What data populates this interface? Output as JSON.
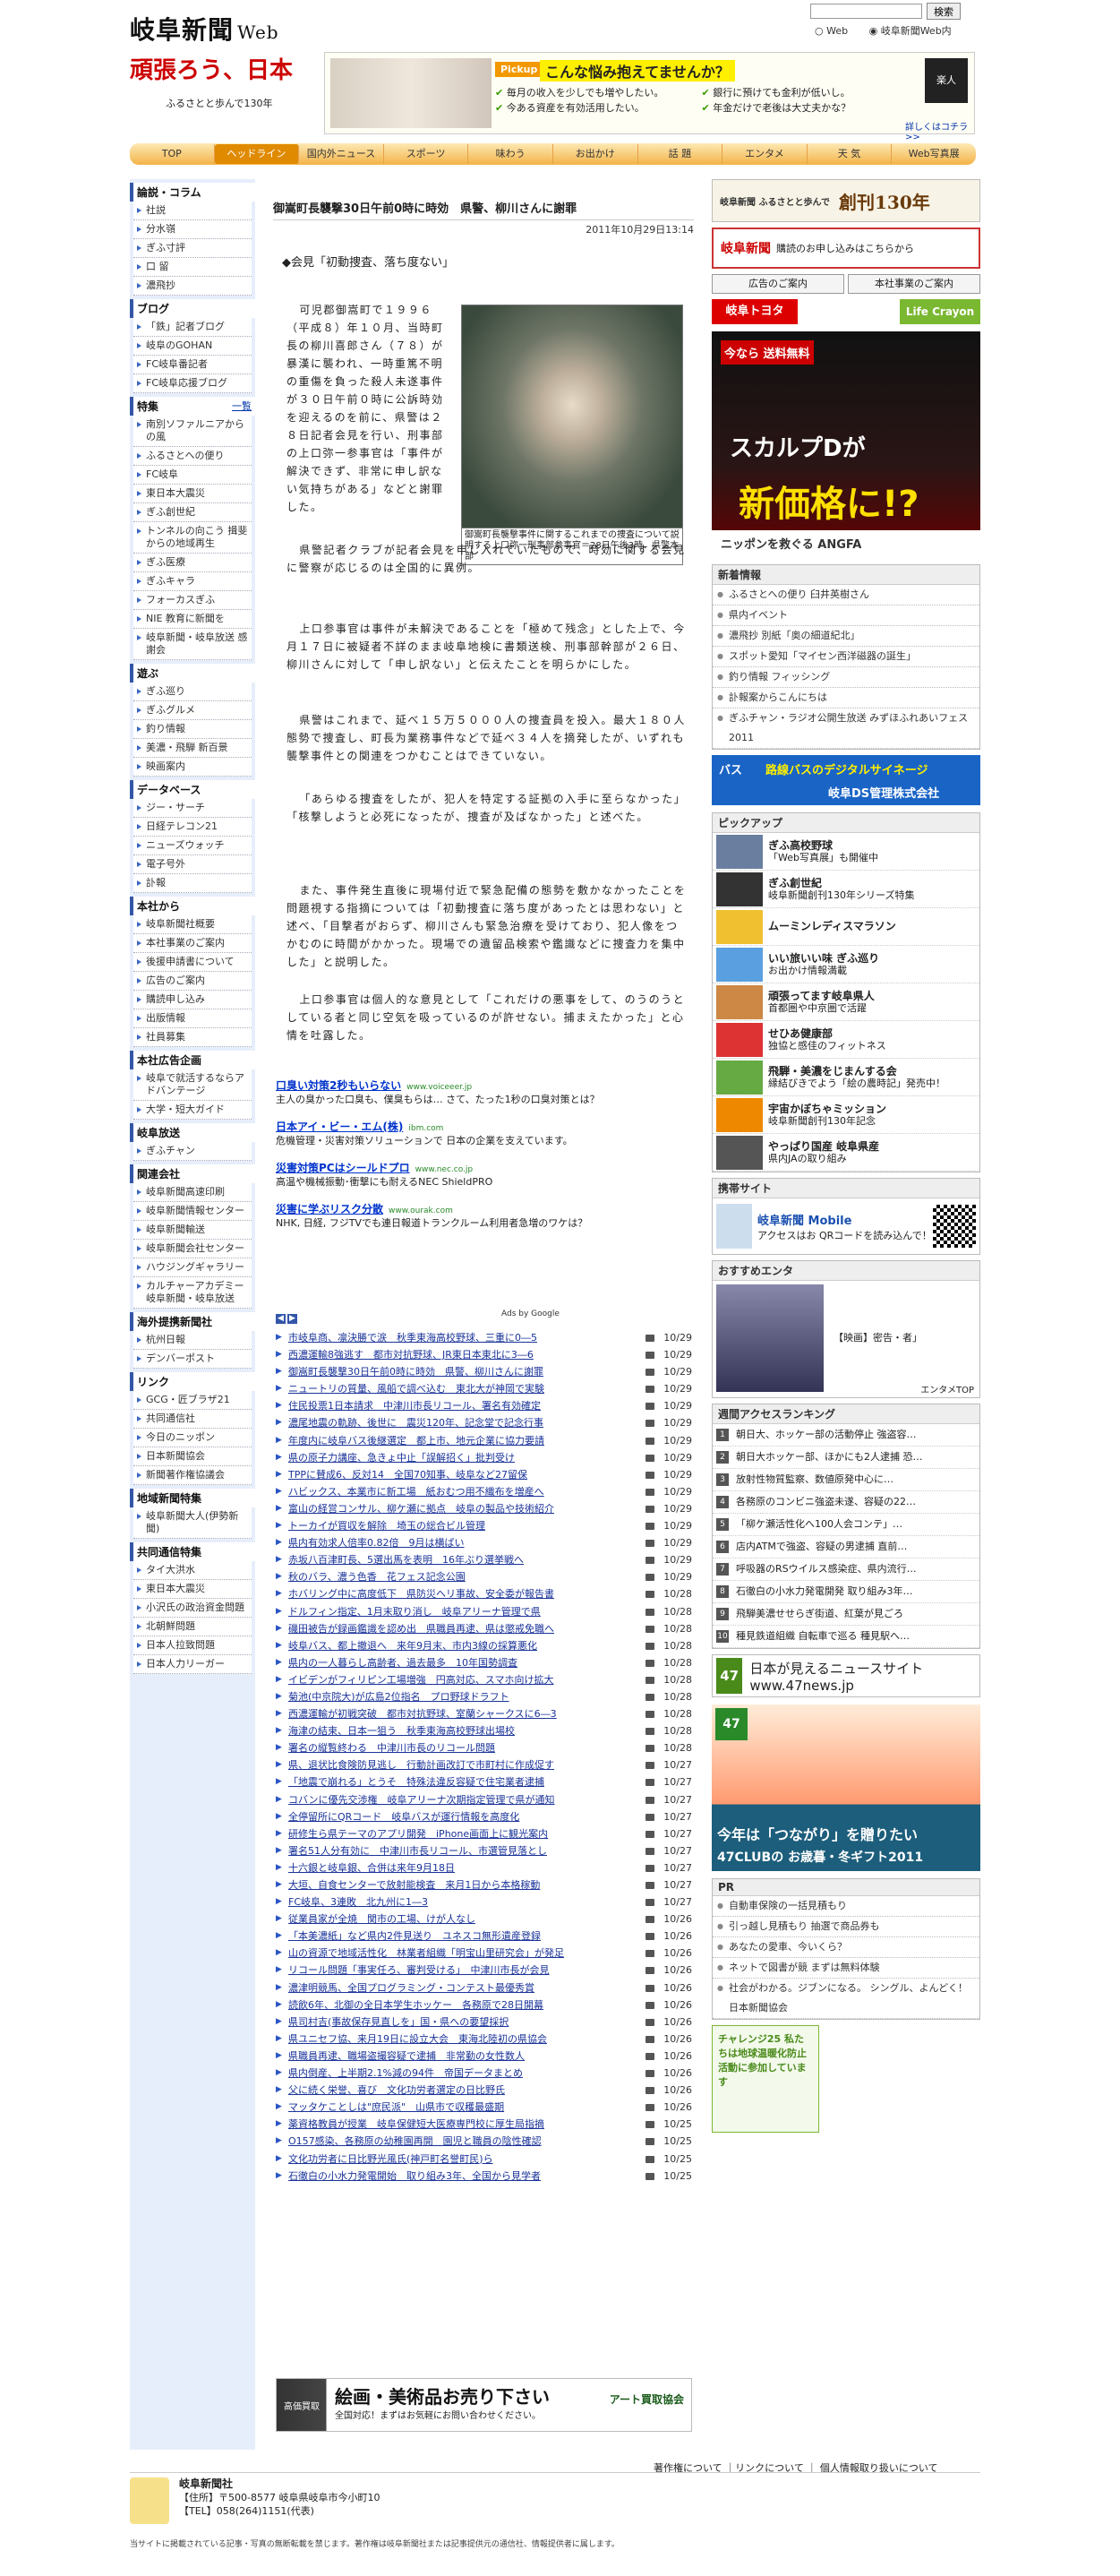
{
  "header": {
    "logo": "岐阜新聞",
    "logo_web": "Web",
    "search_button": "検索",
    "radio_web": "Web",
    "radio_site": "岐阜新聞Web内"
  },
  "banner": {
    "title": "頑張ろう、日本",
    "subtitle": "ふるさとと歩んで130年",
    "pickup_tag": "Pickup",
    "pickup_headline": "こんな悩み抱えてませんか？",
    "pickup_items": [
      "毎月の收入を少しでも増やしたい。",
      "今ある資産を有効活用したい。",
      "銀行に預けても金利が低いし。",
      "年金だけで老後は大丈夫かな？"
    ],
    "rakujin": "楽人",
    "detail_link": "詳しくはコチラ >>"
  },
  "nav": [
    "TOP",
    "ヘッドライン",
    "国内外ニュース",
    "スポーツ",
    "味わう",
    "お出かけ",
    "話 題",
    "エンタメ",
    "天 気",
    "Web写真展"
  ],
  "left": {
    "sections": [
      {
        "title": "論説・コラム",
        "more": "",
        "items": [
          "社説",
          "分水嶺",
          "ぎふ寸評",
          "口 留",
          "濃飛抄"
        ]
      },
      {
        "title": "ブログ",
        "more": "",
        "items": [
          "「鉄」記者ブログ",
          "岐阜のGOHAN",
          "FC岐阜番記者",
          "FC岐阜応援ブログ"
        ]
      },
      {
        "title": "特集",
        "more": "一覧",
        "items": [
          "南別ソファルニアからの風",
          "ふるさとへの便り",
          "FC岐阜",
          "東日本大震災",
          "ぎふ創世紀",
          "トンネルの向こう 揖斐からの地域再生",
          "ぎふ医療",
          "ぎふキャラ",
          "フォーカスぎふ",
          "NIE 教育に新聞を",
          "岐阜新聞・岐阜放送 感謝会"
        ]
      },
      {
        "title": "遊ぶ",
        "more": "",
        "items": [
          "ぎふ巡り",
          "ぎふグルメ",
          "釣り情報",
          "美濃・飛騨 新百景",
          "映画案内"
        ]
      },
      {
        "title": "データベース",
        "more": "",
        "items": [
          "ジー・サーチ",
          "日経テレコン21",
          "ニューズウォッチ",
          "電子号外",
          "訃報"
        ]
      },
      {
        "title": "本社から",
        "more": "",
        "items": [
          "岐阜新聞社概要",
          "本社事業のご案内",
          "後援申請書について",
          "広告のご案内",
          "購読申し込み",
          "出版情報",
          "社員募集"
        ]
      },
      {
        "title": "本社広告企画",
        "more": "",
        "items": [
          "岐阜で就活するならアドバンテージ",
          "大学・短大ガイド"
        ]
      },
      {
        "title": "岐阜放送",
        "more": "",
        "items": [
          "ぎふチャン"
        ]
      },
      {
        "title": "関連会社",
        "more": "",
        "items": [
          "岐阜新聞高速印刷",
          "岐阜新聞情報センター",
          "岐阜新聞輸送",
          "岐阜新聞会社センター",
          "ハウジングギャラリー",
          "カルチャーアカデミー 岐阜新聞・岐阜放送"
        ]
      },
      {
        "title": "海外提携新聞社",
        "more": "",
        "items": [
          "杭州日報",
          "デンバーポスト"
        ]
      },
      {
        "title": "リンク",
        "more": "",
        "items": [
          "GCG・匠ブラザ21",
          "共同通信社",
          "今日のニッポン",
          "日本新聞協会",
          "新聞著作権協議会"
        ]
      },
      {
        "title": "地域新聞特集",
        "more": "",
        "items": [
          "岐阜新聞大人(伊勢新聞)"
        ]
      },
      {
        "title": "共同通信特集",
        "more": "",
        "items": [
          "タイ大洪水",
          "東日本大震災",
          "小沢氏の政治資金問題",
          "北朝鮮問題",
          "日本人拉致問題",
          "日本人力リーガー"
        ]
      }
    ]
  },
  "article": {
    "headline": "御嵩町長襲撃30日午前0時に時効　県警、柳川さんに謝罪",
    "date": "2011年10月29日13:14",
    "kicker": "◆会見「初動捜査、落ち度ない」",
    "caption": "御嵩町長襲撃事件に関するこれまでの捜査について説明する上口弥一刑事部参事官＝28日午後3時、県警本部",
    "p1": "可児郡御嵩町で１９９６（平成８）年１０月、当時町長の柳川喜郎さん（７８）が暴漢に襲われ、一時重篤不明の重傷を負った殺人未遂事件が３０日午前０時に公訴時効を迎えるのを前に、県警は２８日記者会見を行い、刑事部の上口弥一参事官は「事件が解決できず、非常に申し訳ない気持ちがある」などと謝罪した。",
    "p2": "県警記者クラブが記者会見を申し入れていたもので、時効に関する会見に警察が応じるのは全国的に異例。",
    "p3": "上口参事官は事件が未解決であることを「極めて残念」とした上で、今月１７日に被疑者不詳のまま岐阜地検に書類送検、刑事部幹部が２６日、柳川さんに対して「申し訳ない」と伝えたことを明らかにした。",
    "p4": "県警はこれまで、延べ１５万５０００人の捜査員を投入。最大１８０人態勢で捜査し、町長为業務事件などで延べ３４人を摘発したが、いずれも襲撃事件との関連をつかむことはできていない。",
    "p5": "「あらゆる捜査をしたが、犯人を特定する証拠の入手に至らなかった」「核撃しようと必死になったが、捜査が及ばなかった」と述べた。",
    "p6": "また、事件発生直後に現場付近で緊急配備の態勢を敷かなかったことを問題視する指摘については「初動捜査に落ち度があったとは思わない」と述べ、「目撃者がおらず、柳川さんも緊急治療を受けており、犯人像をつかむのに時間がかかった。現場での遺留品検索や鑑識などに捜査力を集中した」と説明した。",
    "p7": "上口参事官は個人的な意見として「これだけの悪事をして、のうのうとしている者と同じ空気を吸っているのが許せない。捕まえたかった」と心情を吐露した。"
  },
  "ads": [
    {
      "title": "口臭い対策2秒もいらない",
      "url": "www.voiceeer.jp",
      "desc": "主人の臭かった口臭も、僕臭もらは… さて、たった1秒の口臭対策とは？"
    },
    {
      "title": "日本アイ・ビー・エム(株)",
      "url": "ibm.com",
      "desc": "危機管理・災害対策ソリューションで 日本の企業を支えています。"
    },
    {
      "title": "災害対策PCはシールドプロ",
      "url": "www.nec.co.jp",
      "desc": "高温や機械振動･衝撃にも耐えるNEC ShieldPRO"
    },
    {
      "title": "災害に学ぶリスク分散",
      "url": "www.ourak.com",
      "desc": "NHK, 日経, フジTVでも連日報道トランクルーム利用者急増のワケは？"
    }
  ],
  "ads_by": "Ads by Google",
  "news": [
    {
      "t": "市岐阜商、凛決勝で涙　秋季東海高校野球、三重に0―5",
      "d": "10/29"
    },
    {
      "t": "西濃運輸8強逃す　都市対抗野球、JR東日本東北に3―6",
      "d": "10/29"
    },
    {
      "t": "御嵩町長襲撃30日午前0時に時効　県警、柳川さんに謝罪",
      "d": "10/29"
    },
    {
      "t": "ニュートリの質量、風船で調べ込む　東北大が神岡で実験",
      "d": "10/29"
    },
    {
      "t": "住民投票1日本請求　中津川市長リコール、署名有効確定",
      "d": "10/29"
    },
    {
      "t": "濃尾地震の軌跡、後世に　震災120年、記念堂で記念行事",
      "d": "10/29"
    },
    {
      "t": "年度内に岐阜バス後継選定　都上市、地元企業に協力要請",
      "d": "10/29"
    },
    {
      "t": "県の原子力講座、急きょ中止「誤解招く」批判受け",
      "d": "10/29"
    },
    {
      "t": "TPPに賛成6、反対14　全国70知事、岐阜など27留保",
      "d": "10/29"
    },
    {
      "t": "ハビックス、本業市に新工場　紙おむつ用不織布を増産へ",
      "d": "10/29"
    },
    {
      "t": "富山の経営コンサル、柳ケ瀬に拠点　岐阜の製品や技術紹介",
      "d": "10/29"
    },
    {
      "t": "トーカイが買収を解除　埼玉の総合ビル管理",
      "d": "10/29"
    },
    {
      "t": "県内有効求人倍率0.82倍　9月は横ばい",
      "d": "10/29"
    },
    {
      "t": "赤坂八百津町長、5選出馬を表明　16年ぶり選挙戦へ",
      "d": "10/29"
    },
    {
      "t": "秋のバラ、濃う色香　花フェス記念公園",
      "d": "10/29"
    },
    {
      "t": "ホバリング中に高度低下　県防災ヘリ事故、安全委が報告書",
      "d": "10/28"
    },
    {
      "t": "ドルフィン指定、1月末取り消し　岐阜アリーナ管理で県",
      "d": "10/28"
    },
    {
      "t": "磯田被告が録画鑑識を認め出　県職員再逮、県は懲戒免職へ",
      "d": "10/28"
    },
    {
      "t": "岐阜バス、都上撤退へ　来年9月末、市内3線の採算悪化",
      "d": "10/28"
    },
    {
      "t": "県内の一人暮らし高齢者、過去最多　10年国勢調査",
      "d": "10/28"
    },
    {
      "t": "イビデンがフィリピン工場増強　円高対応、スマホ向け拡大",
      "d": "10/28"
    },
    {
      "t": "菊池(中京院大)が広島2位指名　プロ野球ドラフト",
      "d": "10/28"
    },
    {
      "t": "西濃運輸が初戦突破　都市対抗野球、室蘭シャークスに6―3",
      "d": "10/28"
    },
    {
      "t": "海津の結束、日本一狙う　秋季東海高校野球出場校",
      "d": "10/28"
    },
    {
      "t": "署名の縦覧終わる　中津川市長のリコール問題",
      "d": "10/28"
    },
    {
      "t": "県、退状比食険防見逃し　行動計画改訂で市町村に作成促す",
      "d": "10/27"
    },
    {
      "t": "「地震で崩れる」とうそ　特殊法違反容疑で住宅業者逮捕",
      "d": "10/27"
    },
    {
      "t": "コバンに優先交渉権　岐阜アリーナ次期指定管理で県が通知",
      "d": "10/27"
    },
    {
      "t": "全停留所にQRコード　岐阜バスが運行情報を高度化",
      "d": "10/27"
    },
    {
      "t": "研修生ら県テーマのアプリ開発　iPhone画面上に観光案内",
      "d": "10/27"
    },
    {
      "t": "署名51人分有効に　中津川市長リコール、市選管見落とし",
      "d": "10/27"
    },
    {
      "t": "十六銀と岐阜銀、合併は来年9月18日",
      "d": "10/27"
    },
    {
      "t": "大垣、自食センターで放射能検査　来月1日から本格稼動",
      "d": "10/27"
    },
    {
      "t": "FC岐阜、3連敗　北九州に1―3",
      "d": "10/27"
    },
    {
      "t": "従業員家が全焼　関市の工場、けが人なし",
      "d": "10/26"
    },
    {
      "t": "「本美濃紙」など県内2件見送り　ユネスコ無形遺産登録",
      "d": "10/26"
    },
    {
      "t": "山の資源で地域活性化　林業者組織「明宝山里研究会」が発足",
      "d": "10/26"
    },
    {
      "t": "リコール問題「事実任ろ、審判受ける」　中津川市長が会見",
      "d": "10/26"
    },
    {
      "t": "濃津明競馬、全国プログラミング・コンテスト最優秀賞",
      "d": "10/26"
    },
    {
      "t": "読飲6年、北御の全日本学生ホッケー　各務原で28日開幕",
      "d": "10/26"
    },
    {
      "t": "県司村吉(事故保存見直しを」国・県への要望採択",
      "d": "10/26"
    },
    {
      "t": "県ユニセフ協、来月19日に設立大会　東海北陸初の県協会",
      "d": "10/26"
    },
    {
      "t": "県職員再逮、職場盗撮容疑で逮捕　非常勤の女性数人",
      "d": "10/26"
    },
    {
      "t": "県内倒産、上半期2.1%減の94件　帝国データまとめ",
      "d": "10/26"
    },
    {
      "t": "父に続く栄誉、喜び　文化功労者選定の日比野氏",
      "d": "10/26"
    },
    {
      "t": "マッタケことしは\"庶民派\"　山県市で収穫最盛期",
      "d": "10/26"
    },
    {
      "t": "薬資格教員が授業　岐阜保健短大医療専門校に厚生局指摘",
      "d": "10/25"
    },
    {
      "t": "O157感染、各務原の幼稚園再開　園児と職員の陰性確認",
      "d": "10/25"
    },
    {
      "t": "文化功労者に日比野光風氏(神戸町名誉町民)ら",
      "d": "10/25"
    },
    {
      "t": "石徹白の小水力発電開始　取り組み3年、全国から見学者",
      "d": "10/25"
    }
  ],
  "art_banner": {
    "head": "絵画・美術品お売り下さい",
    "sub": "全国対応！まずはお気軽にお問い合わせください。",
    "right": "アート買取協会",
    "left": "高価買取"
  },
  "right": {
    "anniv": "創刊130年",
    "anniv_pre": "岐阜新聞 ふるさとと歩んで",
    "subscribe_brand": "岐阜新聞",
    "subscribe_text": "購読のお申し込みはこちらから",
    "ad_guide": "広告のご案内",
    "events": "本社事業のご案内",
    "toyota": "岐阜トヨタ",
    "lifecrayon": "Life Crayon",
    "scalp_tag": "今なら 送料無料",
    "scalp_name": "スカルプDが",
    "scalp_big": "新価格に!?",
    "scalp_foot": "ニッポンを救ぐる ANGFA",
    "new_head": "新着情報",
    "new_items": [
      "ふるさとへの便り 臼井英樹さん",
      "県内イベント",
      "濃飛抄 別紙「奥の細道紀北」",
      "スポット愛知「マイセン西洋磁器の誕生」",
      "釣り情報 フィッシング",
      "訃報案からこんにちは",
      "ぎふチャン・ラジオ公開生放送 みずほふれあいフェス2011"
    ],
    "bus_a": "バス",
    "bus_b": "路線バスのデジタルサイネージ",
    "bus_c": "岐阜DS管理株式会社",
    "pickup_head": "ピックアップ",
    "pickups": [
      {
        "t": "ぎふ高校野球",
        "s": "「Web写真展」も開催中"
      },
      {
        "t": "ぎふ創世紀",
        "s": "岐阜新聞創刊130年シリーズ特集"
      },
      {
        "t": "ムーミンレディスマラソン",
        "s": ""
      },
      {
        "t": "いい旅いい味 ぎふ巡り",
        "s": "お出かけ情報満載"
      },
      {
        "t": "頑張ってます岐阜県人",
        "s": "首都圏や中京圏で活躍"
      },
      {
        "t": "せひあ健康部",
        "s": "独協と感佳のフィットネス"
      },
      {
        "t": "飛騨・美濃をじまんする会",
        "s": "縁結びきでよう「絵の農時記」発売中！"
      },
      {
        "t": "宇宙かぼちゃミッション",
        "s": "岐阜新聞創刊130年記念"
      },
      {
        "t": "やっぱり国産 岐阜県産",
        "s": "県内JAの取り組み"
      }
    ],
    "mobile_head": "携帯サイト",
    "mobile_brand": "岐阜新聞 Mobile",
    "mobile_text": "アクセスはお QRコードを読み込んで！",
    "enta_head": "おすすめエンタ",
    "enta_title": "【映画】密告・者」",
    "enta_more": "エンタメTOP",
    "rank_head": "週間アクセスランキング",
    "ranks": [
      "朝日大、ホッケー部の活動停止 強盗容…",
      "朝日大ホッケー部、ほかにも2人逮捕 恐…",
      "放射性物質監察、数値原発中心に…",
      "各務原のコンビニ強盗未遂、容疑の22…",
      "「柳ケ瀬活性化へ100人会コンテ」…",
      "店内ATMで強盗、容疑の男逮捕 直前…",
      "呼吸器のRSウイルス感染症、県内流行…",
      "石徹白の小水力発電開発 取り組み3年…",
      "飛騨美濃せせらぎ街道、紅葉が見ごろ",
      "種見鉄道組織 自転車で巡る 種見駅へ…"
    ],
    "news47": "日本が見えるニュースサイト www.47news.jp",
    "news47_badge": "47",
    "gift_tag": "47",
    "gift_text": "今年は「つながり」を贈りたい",
    "gift_big": "47CLUBの お歳暮・冬ギフト2011",
    "pr_head": "PR",
    "pr_items": [
      "自動車保険の一括見積もり",
      "引っ越し見積もり 抽選で商品券も",
      "あなたの愛車、今いくら？",
      "ネットで図書が競 まずは無料体験",
      "社会がわかる。ジブンになる。 シングル、よんどく！ 日本新聞協会"
    ],
    "challenge": "チャレンジ25 私たちは地球温暖化防止活動に参加しています"
  },
  "footer": {
    "links": "著作権について ｜リンクについて ｜ 個人情報取り扱いについて",
    "company": "岐阜新聞社",
    "address": "【住所】〒500-8577 岐阜県岐阜市今小町10",
    "tel": "【TEL】058(264)1151(代表)",
    "copyright": "当サイトに掲載されている記事・写真の無断転載を禁じます。著作権は岐阜新聞社または記事提供元の通信社、情報提供者に属します。"
  }
}
